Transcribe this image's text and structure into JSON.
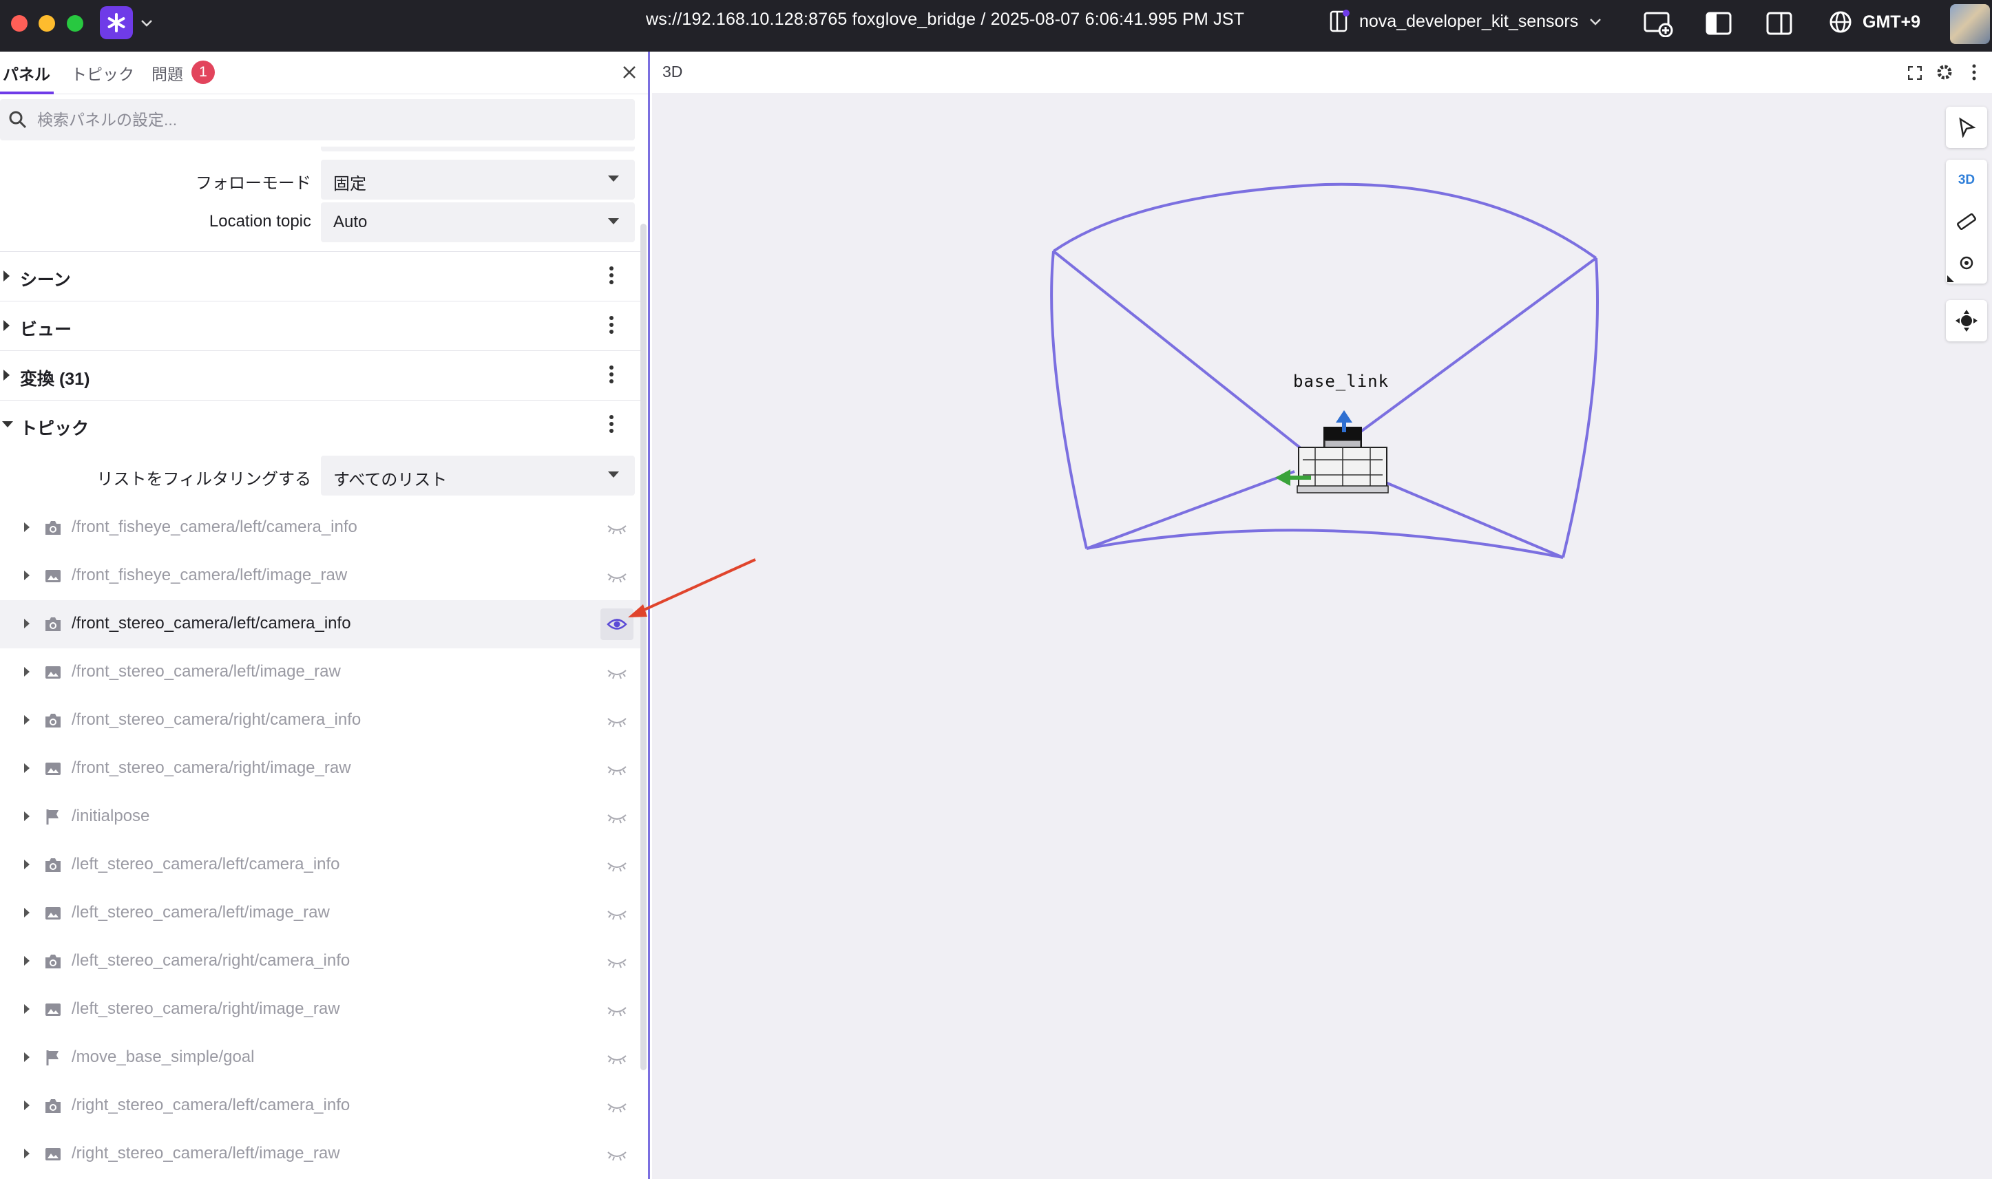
{
  "titlebar": {
    "connection": "ws://192.168.10.128:8765 foxglove_bridge / 2025-08-07 6:06:41.995 PM JST",
    "layout_name": "nova_developer_kit_sensors",
    "timezone": "GMT+9"
  },
  "sidebar": {
    "tabs": [
      {
        "label": "パネル",
        "active": true
      },
      {
        "label": "トピック",
        "active": false
      },
      {
        "label": "問題",
        "active": false,
        "badge": "1"
      }
    ],
    "search": {
      "placeholder": "検索パネルの設定...",
      "value": ""
    },
    "fields": [
      {
        "label": "フォローモード",
        "value": "固定"
      },
      {
        "label": "Location topic",
        "value": "Auto"
      }
    ],
    "sections": [
      {
        "label": "シーン",
        "expanded": false
      },
      {
        "label": "ビュー",
        "expanded": false
      },
      {
        "label": "変換 (31)",
        "expanded": false
      },
      {
        "label": "トピック",
        "expanded": true
      }
    ],
    "filter": {
      "label": "リストをフィルタリングする",
      "value": "すべてのリスト"
    },
    "topics": [
      {
        "name": "/front_fisheye_camera/left/camera_info",
        "icon": "camera-icon",
        "visible": false
      },
      {
        "name": "/front_fisheye_camera/left/image_raw",
        "icon": "image-icon",
        "visible": false
      },
      {
        "name": "/front_stereo_camera/left/camera_info",
        "icon": "camera-icon",
        "visible": true
      },
      {
        "name": "/front_stereo_camera/left/image_raw",
        "icon": "image-icon",
        "visible": false
      },
      {
        "name": "/front_stereo_camera/right/camera_info",
        "icon": "camera-icon",
        "visible": false
      },
      {
        "name": "/front_stereo_camera/right/image_raw",
        "icon": "image-icon",
        "visible": false
      },
      {
        "name": "/initialpose",
        "icon": "flag-icon",
        "visible": false
      },
      {
        "name": "/left_stereo_camera/left/camera_info",
        "icon": "camera-icon",
        "visible": false
      },
      {
        "name": "/left_stereo_camera/left/image_raw",
        "icon": "image-icon",
        "visible": false
      },
      {
        "name": "/left_stereo_camera/right/camera_info",
        "icon": "camera-icon",
        "visible": false
      },
      {
        "name": "/left_stereo_camera/right/image_raw",
        "icon": "image-icon",
        "visible": false
      },
      {
        "name": "/move_base_simple/goal",
        "icon": "flag-icon",
        "visible": false
      },
      {
        "name": "/right_stereo_camera/left/camera_info",
        "icon": "camera-icon",
        "visible": false
      },
      {
        "name": "/right_stereo_camera/left/image_raw",
        "icon": "image-icon",
        "visible": false
      }
    ]
  },
  "panel": {
    "title": "3D",
    "frame_label": "base_link",
    "toolbar": [
      "select-icon",
      "3D",
      "ruler-icon",
      "target-icon",
      "orbit-icon"
    ]
  },
  "colors": {
    "accent": "#6f3be8",
    "frustum": "#7b6fe0",
    "badge": "#e2445c",
    "annotation": "#e0442c",
    "axis_x": "#3aa33a",
    "axis_z": "#2f6fd1"
  }
}
